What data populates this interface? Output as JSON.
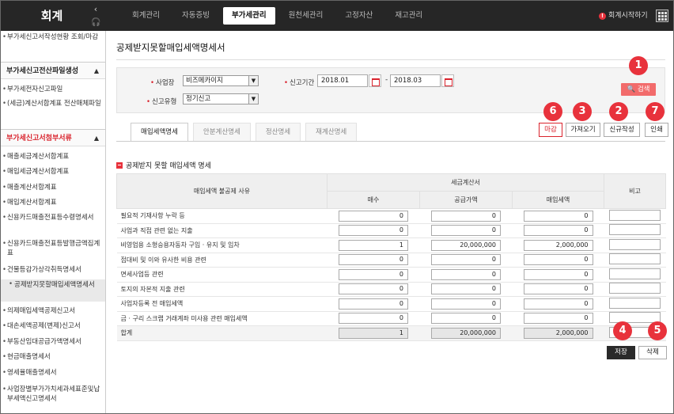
{
  "app": {
    "brand": "회계",
    "collapse_icon": "‹",
    "help_icon": "headset-icon"
  },
  "topnav": {
    "items": [
      "회계관리",
      "자동증빙",
      "부가세관리",
      "원천세관리",
      "고정자산",
      "재고관리"
    ],
    "active_index": 2,
    "start_label": "회계시작하기"
  },
  "sidebar": {
    "items": [
      {
        "type": "item",
        "label": "부가세신고서작성현황 조회/마감"
      },
      {
        "type": "head",
        "label": "부가세신고전산파일생성",
        "color": "normal"
      },
      {
        "type": "item",
        "label": "부가세전자신고파일"
      },
      {
        "type": "item",
        "label": "(세금)계산서합계표 전산매체파일"
      },
      {
        "type": "head",
        "label": "부가세신고서첨부서류",
        "color": "red"
      },
      {
        "type": "item",
        "label": "매출세금계산서합계표"
      },
      {
        "type": "item",
        "label": "매입세금계산서합계표"
      },
      {
        "type": "item",
        "label": "매출계산서합계표"
      },
      {
        "type": "item",
        "label": "매입계산서합계표"
      },
      {
        "type": "item",
        "label": "신용카드매출전표등수령명세서"
      },
      {
        "type": "item",
        "label": "신용카드매출전표등발행금액집계표"
      },
      {
        "type": "item",
        "label": "건물등감가상각취득명세서"
      },
      {
        "type": "item",
        "label": "공제받지못할매입세액명세서",
        "active": true
      },
      {
        "type": "item",
        "label": "의제매입세액공제신고서"
      },
      {
        "type": "item",
        "label": "대손세액공제(변제)신고서"
      },
      {
        "type": "item",
        "label": "부동산임대공급가액명세서"
      },
      {
        "type": "item",
        "label": "현금매출명세서"
      },
      {
        "type": "item",
        "label": "영세율매출명세서"
      },
      {
        "type": "item",
        "label": "사업장별부가가치세과세표준및납부세액신고명세서"
      }
    ]
  },
  "page": {
    "title": "공제받지못할매입세액명세서"
  },
  "search": {
    "business_label": "사업장",
    "business_value": "비즈메카이지",
    "period_label": "신고기간",
    "period_from": "2018.01",
    "period_to": "2018.03",
    "type_label": "신고유형",
    "type_value": "정기신고",
    "search_label": "검색",
    "dash": "-"
  },
  "tabs": [
    "매입세액명세",
    "안분계산명세",
    "정산명세",
    "재계산명세"
  ],
  "actions": {
    "close": "마감",
    "import": "가져오기",
    "new": "신규작성",
    "print": "인쇄",
    "save": "저장",
    "delete": "삭제"
  },
  "badges": [
    "1",
    "2",
    "3",
    "4",
    "5",
    "6",
    "7"
  ],
  "section": {
    "title": "공제받지 못할 매입세액 명세"
  },
  "table": {
    "col_reason": "매입세액 불공제 사유",
    "col_tax_invoice": "세금계산서",
    "col_count": "매수",
    "col_supply": "공급가액",
    "col_tax": "매입세액",
    "col_note": "비고",
    "rows": [
      {
        "reason": "필요적 기재사항 누락 등",
        "count": "0",
        "supply": "0",
        "tax": "0",
        "note": ""
      },
      {
        "reason": "사업과 직접 관련 없는 지출",
        "count": "0",
        "supply": "0",
        "tax": "0",
        "note": ""
      },
      {
        "reason": "비영업용 소형승용자동차 구입 · 유지 및 임차",
        "count": "1",
        "supply": "20,000,000",
        "tax": "2,000,000",
        "note": ""
      },
      {
        "reason": "접대비 및 이와 유사한 비용 관련",
        "count": "0",
        "supply": "0",
        "tax": "0",
        "note": ""
      },
      {
        "reason": "면세사업등 관련",
        "count": "0",
        "supply": "0",
        "tax": "0",
        "note": ""
      },
      {
        "reason": "토지의 자본적 지출 관련",
        "count": "0",
        "supply": "0",
        "tax": "0",
        "note": ""
      },
      {
        "reason": "사업자등록 전 매입세액",
        "count": "0",
        "supply": "0",
        "tax": "0",
        "note": ""
      },
      {
        "reason": "금 · 구리 스크랩 거래계좌 미사용 관련 매입세액",
        "count": "0",
        "supply": "0",
        "tax": "0",
        "note": ""
      }
    ],
    "total": {
      "reason": "합계",
      "count": "1",
      "supply": "20,000,000",
      "tax": "2,000,000",
      "note": ""
    }
  }
}
